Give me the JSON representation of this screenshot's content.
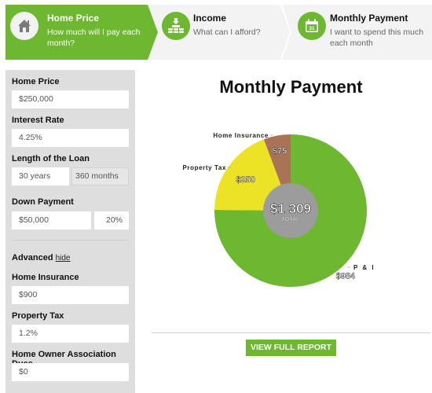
{
  "steps": [
    {
      "title": "Home Price",
      "subtitle": "How much will I pay each month?",
      "icon": "house-icon",
      "active": true
    },
    {
      "title": "Income",
      "subtitle": "What can I afford?",
      "icon": "coins-icon",
      "active": false
    },
    {
      "title": "Monthly Payment",
      "subtitle": "I want to spend this much each month",
      "icon": "calendar-icon",
      "calendar_day": "31",
      "active": false
    }
  ],
  "form": {
    "home_price": {
      "label": "Home Price",
      "value": "$250,000"
    },
    "interest_rate": {
      "label": "Interest Rate",
      "value": "4.25%"
    },
    "loan_length": {
      "label": "Length of the Loan",
      "years": "30 years",
      "months": "360 months"
    },
    "down_payment": {
      "label": "Down Payment",
      "amount": "$50,000",
      "percent": "20%"
    },
    "advanced": {
      "label": "Advanced",
      "toggle": "hide"
    },
    "home_insurance": {
      "label": "Home Insurance",
      "value": "$900"
    },
    "property_tax": {
      "label": "Property Tax",
      "value": "1.2%"
    },
    "hoa_dues": {
      "label": "Home Owner Association Dues",
      "value": "$0"
    }
  },
  "report_button": "VIEW FULL REPORT",
  "colors": {
    "accent": "#6db731",
    "pi": "#6db731",
    "property_tax": "#ece226",
    "home_insurance": "#a97356",
    "center": "#9c9c9c"
  },
  "chart_data": {
    "type": "pie",
    "title": "Monthly Payment",
    "donut": true,
    "center_value": "$1 309",
    "center_label": "TOTAL",
    "slices": [
      {
        "name": "P & I",
        "value": 984,
        "label": "$984",
        "color": "#6db731"
      },
      {
        "name": "Property Tax",
        "value": 250,
        "label": "$250",
        "color": "#ece226"
      },
      {
        "name": "Home Insurance",
        "value": 75,
        "label": "$75",
        "color": "#a97356"
      }
    ],
    "total": 1309
  }
}
